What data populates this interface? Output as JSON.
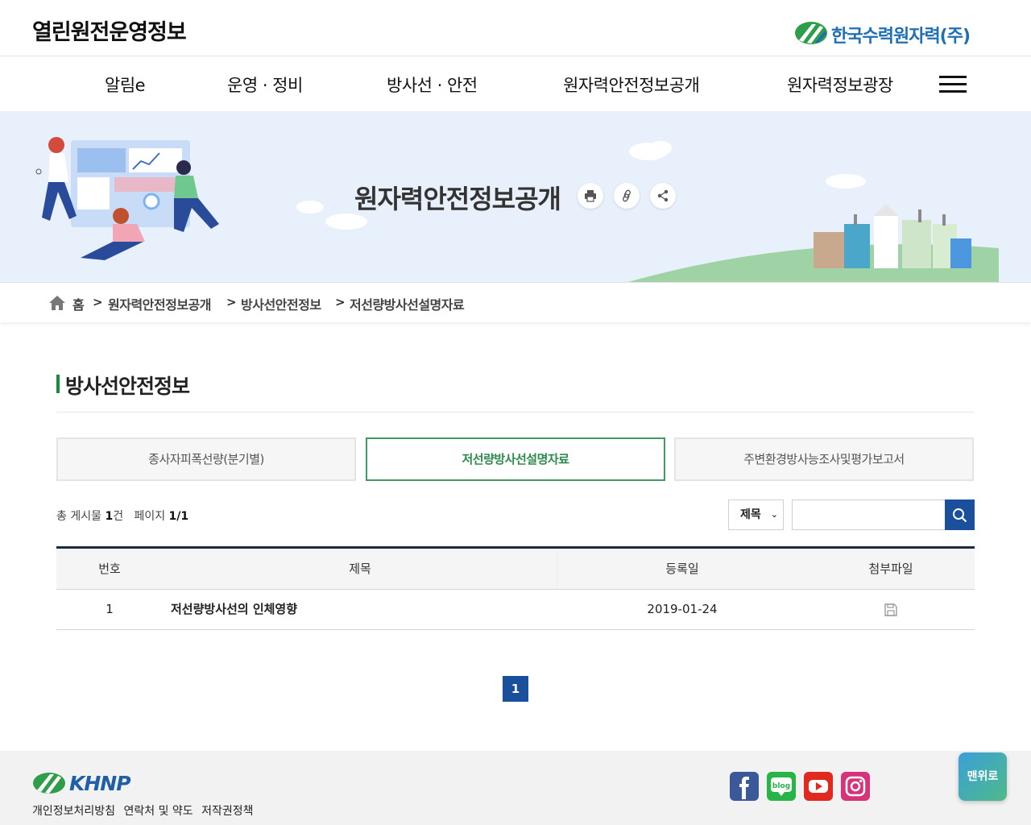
{
  "header": {
    "site_title": "열린원전운영정보",
    "org_name": "한국수력원자력(주)"
  },
  "gnb": {
    "items": [
      "알림e",
      "운영 · 정비",
      "방사선 · 안전",
      "원자력안전정보공개",
      "원자력정보광장"
    ],
    "menu_icon": "hamburger-menu-icon"
  },
  "banner": {
    "title": "원자력안전정보공개",
    "buttons": [
      "print-icon",
      "link-icon",
      "share-icon"
    ]
  },
  "breadcrumb": {
    "home": "홈",
    "items": [
      "원자력안전정보공개",
      "방사선안전정보",
      "저선량방사선설명자료"
    ],
    "separator": ">"
  },
  "section": {
    "title": "방사선안전정보"
  },
  "tabs": [
    {
      "label": "종사자피폭선량(분기별)",
      "active": false
    },
    {
      "label": "저선량방사선설명자료",
      "active": true
    },
    {
      "label": "주변환경방사능조사및평가보고서",
      "active": false
    }
  ],
  "board": {
    "total_label": "총 게시물",
    "total_count": "1",
    "count_unit": "건",
    "page_label": "페이지",
    "page_value": "1/1"
  },
  "search": {
    "select_value": "제목",
    "input_value": "",
    "button_icon": "search-icon"
  },
  "table": {
    "columns": [
      "번호",
      "제목",
      "등록일",
      "첨부파일"
    ],
    "rows": [
      {
        "no": "1",
        "title": "저선량방사선의 인체영향",
        "date": "2019-01-24",
        "attachment_icon": "file-icon"
      }
    ]
  },
  "pagination": {
    "current": "1"
  },
  "footer": {
    "logo": "KHNP",
    "links": [
      "개인정보처리방침",
      "연락처 및 약도",
      "저작권정책"
    ],
    "sns": [
      "facebook-icon",
      "blog-icon",
      "youtube-icon",
      "instagram-icon"
    ],
    "sns_blog_text": "blog",
    "top_button": "맨위로"
  },
  "colors": {
    "accent_green": "#2d8a4e",
    "primary_blue": "#1a4f9c",
    "banner_bg": "#e8f0fb"
  }
}
